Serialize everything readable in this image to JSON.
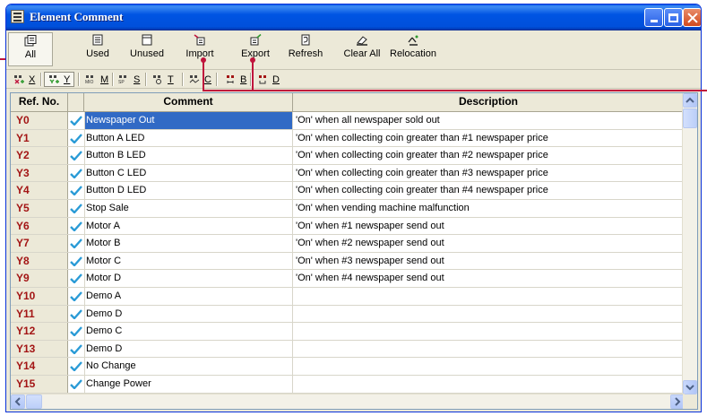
{
  "window": {
    "title": "Element Comment"
  },
  "toolbar": {
    "items": [
      {
        "label": "All"
      },
      {
        "label": "Used"
      },
      {
        "label": "Unused"
      },
      {
        "label": "Import"
      },
      {
        "label": "Export"
      },
      {
        "label": "Refresh"
      },
      {
        "label": "Clear All"
      },
      {
        "label": "Relocation"
      }
    ]
  },
  "filters": [
    {
      "label": "X"
    },
    {
      "label": "Y"
    },
    {
      "label": "M"
    },
    {
      "label": "S"
    },
    {
      "label": "T"
    },
    {
      "label": "C"
    },
    {
      "label": "B"
    },
    {
      "label": "D"
    }
  ],
  "table": {
    "headers": {
      "ref": "Ref. No.",
      "comment": "Comment",
      "description": "Description"
    },
    "rows": [
      {
        "ref": "Y0",
        "comment": "Newspaper Out",
        "description": "'On' when all newspaper sold out"
      },
      {
        "ref": "Y1",
        "comment": "Button A LED",
        "description": "'On' when collecting coin greater than #1 newspaper price"
      },
      {
        "ref": "Y2",
        "comment": "Button B LED",
        "description": "'On' when collecting coin greater than #2 newspaper price"
      },
      {
        "ref": "Y3",
        "comment": "Button C LED",
        "description": "'On' when collecting coin greater than #3 newspaper price"
      },
      {
        "ref": "Y4",
        "comment": "Button D LED",
        "description": "'On' when collecting coin greater than #4 newspaper price"
      },
      {
        "ref": "Y5",
        "comment": "Stop Sale",
        "description": "'On' when vending machine malfunction"
      },
      {
        "ref": "Y6",
        "comment": "Motor A",
        "description": "'On' when #1 newspaper send out"
      },
      {
        "ref": "Y7",
        "comment": "Motor B",
        "description": "'On' when #2 newspaper send out"
      },
      {
        "ref": "Y8",
        "comment": "Motor C",
        "description": "'On' when #3 newspaper send out"
      },
      {
        "ref": "Y9",
        "comment": "Motor D",
        "description": "'On' when #4 newspaper send out"
      },
      {
        "ref": "Y10",
        "comment": "Demo A",
        "description": ""
      },
      {
        "ref": "Y11",
        "comment": "Demo D",
        "description": ""
      },
      {
        "ref": "Y12",
        "comment": "Demo C",
        "description": ""
      },
      {
        "ref": "Y13",
        "comment": "Demo D",
        "description": ""
      },
      {
        "ref": "Y14",
        "comment": "No Change",
        "description": ""
      },
      {
        "ref": "Y15",
        "comment": "Change Power",
        "description": ""
      }
    ]
  },
  "colors": {
    "accent": "#a31515",
    "selection": "#316ac5",
    "check": "#2a9bd6",
    "callout": "#c0143c"
  }
}
